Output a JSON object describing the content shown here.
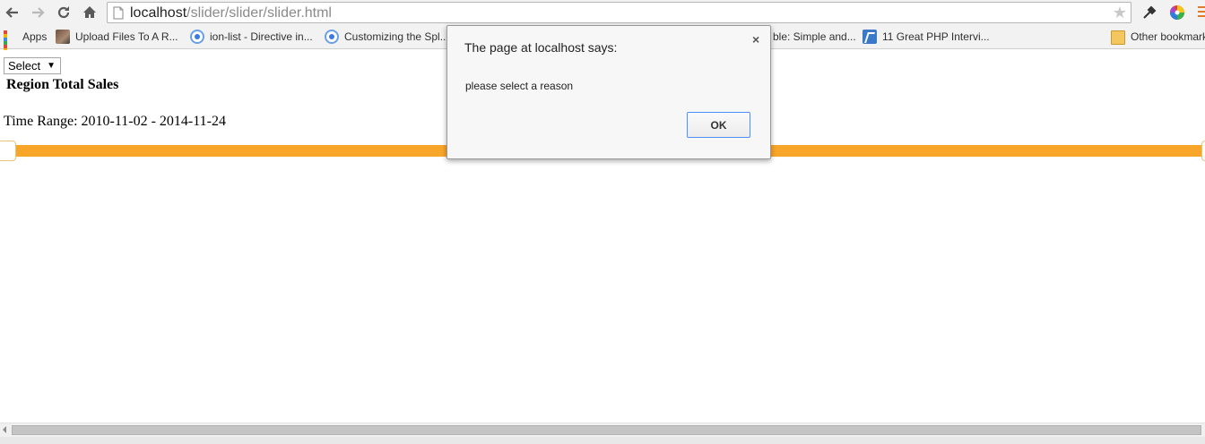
{
  "browser": {
    "url_host": "localhost",
    "url_path": "/slider/slider/slider.html"
  },
  "bookmarks": [
    {
      "label": "Apps",
      "icon": "apps-grid-icon"
    },
    {
      "label": "Upload Files To A R...",
      "icon": "photo-icon"
    },
    {
      "label": "ion-list - Directive in...",
      "icon": "chrome-page-icon"
    },
    {
      "label": "Customizing the Spl...",
      "icon": "chrome-page-icon"
    },
    {
      "label": "ble: Simple and...",
      "icon": "none"
    },
    {
      "label": "11 Great PHP Intervi...",
      "icon": "php-icon"
    },
    {
      "label": "Other bookmarks",
      "icon": "folder-icon"
    }
  ],
  "page": {
    "select_value": "Select",
    "region_title": "Region Total Sales",
    "time_range": "Time Range: 2010-11-02 - 2014-11-24"
  },
  "dialog": {
    "title": "The page at localhost says:",
    "message": "please select a reason",
    "ok_label": "OK",
    "close_symbol": "×"
  },
  "colors": {
    "slider_track": "#f8a62a",
    "dialog_button_border": "#4d90fe"
  }
}
